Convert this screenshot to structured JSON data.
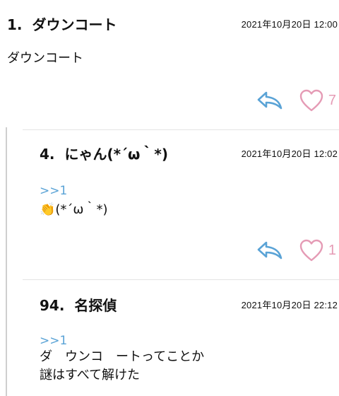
{
  "posts": [
    {
      "number": "1.",
      "name": "ダウンコート",
      "date": "2021年10月20日 12:00",
      "anchor": "",
      "lines": [
        "ダウンコート"
      ],
      "likes": "7"
    },
    {
      "number": "4.",
      "name": "にゃん(*´ω｀*)",
      "date": "2021年10月20日 12:02",
      "anchor": ">>1",
      "lines": [
        "👏(*´ω｀*)"
      ],
      "likes": "1"
    },
    {
      "number": "94.",
      "name": "名探偵",
      "date": "2021年10月20日 22:12",
      "anchor": ">>1",
      "lines": [
        "ダ　ウンコ　ートってことか",
        "謎はすべて解けた"
      ],
      "likes": ""
    }
  ],
  "colors": {
    "accent_blue": "#5aa3d6",
    "like_pink": "#e59bb5"
  },
  "icons": {
    "reply": "reply-arrow-icon",
    "like": "heart-outline-icon"
  }
}
